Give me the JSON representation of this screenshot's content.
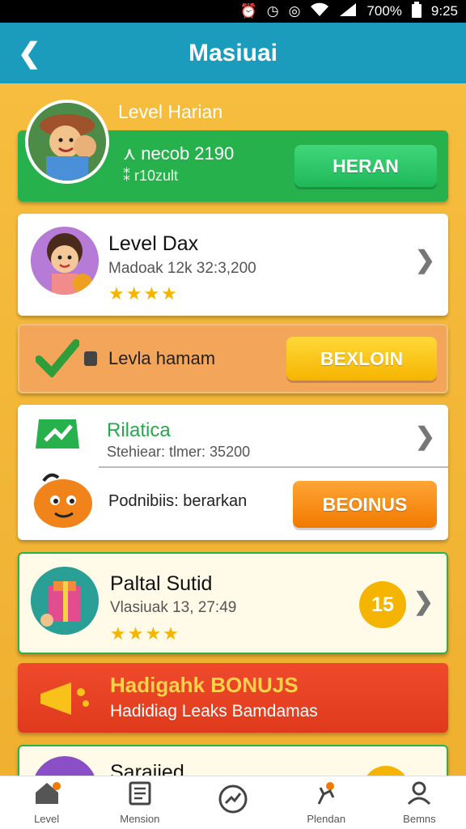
{
  "status_bar": {
    "battery": "700%",
    "time": "9:25"
  },
  "header": {
    "title": "Masiuai"
  },
  "level_harian": {
    "title": "Level Harian",
    "line1": "necob 2190",
    "line2": "r10zult",
    "button": "HERAN"
  },
  "items": [
    {
      "title": "Level Dax",
      "subtitle": "Madoak 12k 32:3,200",
      "stars": "★★★★"
    },
    {
      "label": "Levla hamam",
      "button": "BEXLOIN"
    },
    {
      "title": "Rilatica",
      "subtitle": "Stehiear: tlmer: 35200",
      "sub_label": "Podnibiis: berarkan",
      "button": "BEOINUS"
    },
    {
      "title": "Paltal Sutid",
      "subtitle": "Vlasiuak 13, 27:49",
      "stars": "★★★★",
      "badge": "15"
    },
    {
      "title": "Hadigahk BONUJS",
      "subtitle": "Hadidiag Leaks Bamdamas"
    },
    {
      "title": "Saraiied"
    }
  ],
  "bottom_nav": [
    {
      "label": "Level"
    },
    {
      "label": "Mension"
    },
    {
      "label": ""
    },
    {
      "label": "Plendan"
    },
    {
      "label": "Bemns"
    }
  ]
}
